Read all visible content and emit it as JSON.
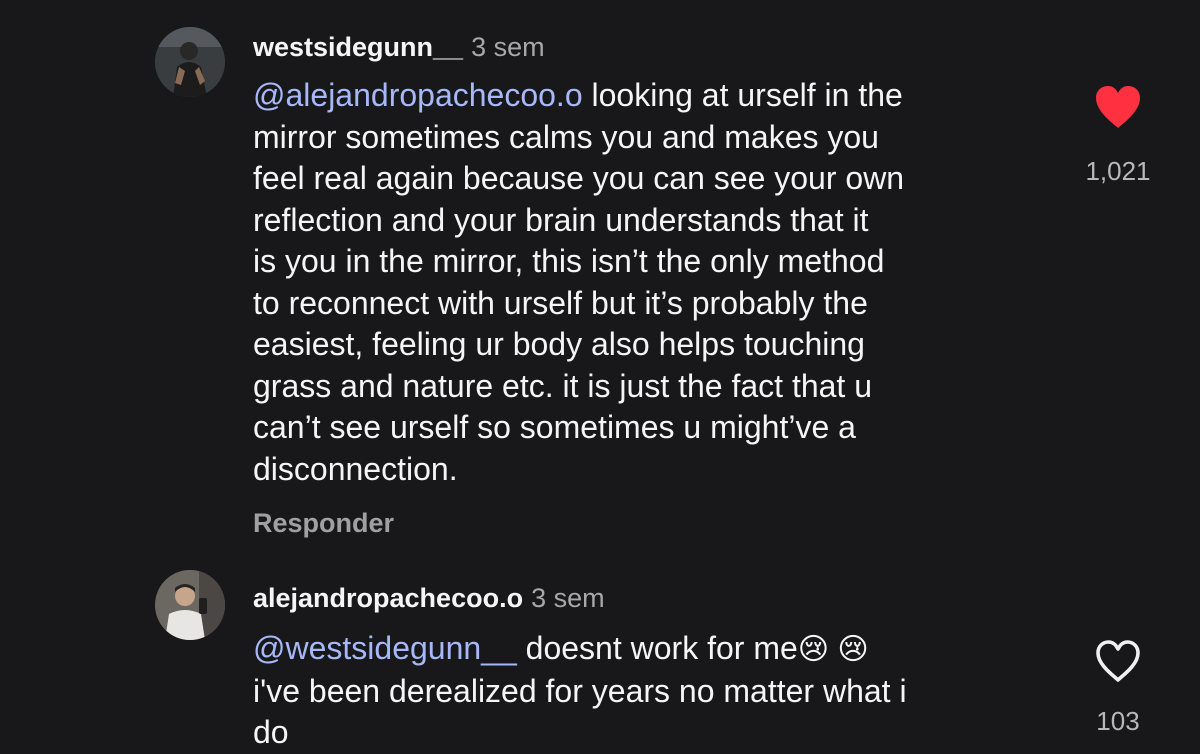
{
  "comments": [
    {
      "username": "westsidegunn__",
      "time": "3 sem",
      "lines": [
        {
          "mention": "@alejandropachecoo.o",
          "text": " looking at urself in the"
        },
        {
          "text": "mirror sometimes calms you and makes you"
        },
        {
          "text": "feel real again because you can see your own"
        },
        {
          "text": "reflection and your brain understands that it"
        },
        {
          "text": "is you in the mirror, this isn’t the only method"
        },
        {
          "text": "to reconnect with urself but it’s probably the"
        },
        {
          "text": "easiest, feeling ur body also helps touching"
        },
        {
          "text": "grass and nature etc. it is just the fact that u"
        },
        {
          "text": "can’t see urself so sometimes u might’ve a"
        },
        {
          "text": "disconnection."
        }
      ],
      "reply_label": "Responder",
      "like_count": "1,021",
      "liked": true
    },
    {
      "username": "alejandropachecoo.o",
      "time": "3 sem",
      "lines": [
        {
          "mention": "@westsidegunn__",
          "text": " doesnt work for me",
          "emoji": "😢 😢"
        },
        {
          "text": "i've been derealized for years no matter what i"
        },
        {
          "text": "do"
        }
      ],
      "like_count": "103",
      "liked": false
    }
  ],
  "icons": {
    "liked": "heart-filled-icon",
    "not_liked": "heart-outline-icon"
  },
  "colors": {
    "background": "#18181b",
    "mention": "#a6b8f7",
    "like_red": "#ff3040",
    "muted": "#a8a8a8"
  }
}
